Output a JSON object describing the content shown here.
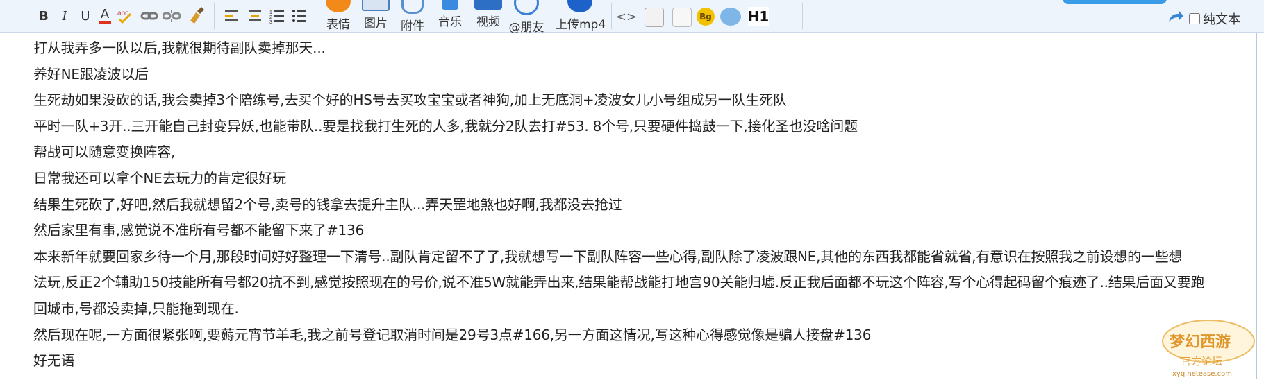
{
  "toolbar": {
    "format_buttons": [
      {
        "name": "bold-button",
        "glyph": "B"
      },
      {
        "name": "italic-button",
        "glyph": "I"
      },
      {
        "name": "underline-button",
        "glyph": "U"
      },
      {
        "name": "font-color-button",
        "glyph": "A"
      }
    ],
    "media": [
      {
        "name": "emoji-button",
        "label": "表情",
        "icon": "emoji-icon",
        "color": "#f08a1c"
      },
      {
        "name": "image-button",
        "label": "图片",
        "icon": "image-icon",
        "color": "#4a7fc1"
      },
      {
        "name": "attachment-button",
        "label": "附件",
        "icon": "attachment-icon",
        "color": "#5a8fd0"
      },
      {
        "name": "music-button",
        "label": "音乐",
        "icon": "music-icon",
        "color": "#3a8be0"
      },
      {
        "name": "video-button",
        "label": "视频",
        "icon": "video-icon",
        "color": "#2c6fc4"
      },
      {
        "name": "mention-button",
        "label": "@朋友",
        "icon": "at-icon",
        "color": "#3c7fd6"
      },
      {
        "name": "upload-mp4-button",
        "label": "上传mp4",
        "icon": "upload-icon",
        "color": "#1d62c9"
      }
    ],
    "heading_label": "H1",
    "bg_label": "Bg",
    "plain_text_label": "纯文本"
  },
  "editor": {
    "lines": [
      "打从我弄多一队以后,我就很期待副队卖掉那天...",
      "养好NE跟凌波以后",
      "生死劫如果没砍的话,我会卖掉3个陪练号,去买个好的HS号去买攻宝宝或者神狗,加上无底洞+凌波女儿小号组成另一队生死队",
      "平时一队+3开..三开能自己封变异妖,也能带队..要是找我打生死的人多,我就分2队去打#53. 8个号,只要硬件捣鼓一下,接化圣也没啥问题",
      "帮战可以随意变换阵容,",
      "日常我还可以拿个NE去玩力的肯定很好玩",
      "结果生死砍了,好吧,然后我就想留2个号,卖号的钱拿去提升主队...弄天罡地煞也好啊,我都没去抢过",
      "然后家里有事,感觉说不准所有号都不能留下来了#136",
      "本来新年就要回家乡待一个月,那段时间好好整理一下清号..副队肯定留不了了,我就想写一下副队阵容一些心得,副队除了凌波跟NE,其他的东西我都能省就省,有意识在按照我之前设想的一些想",
      "法玩,反正2个辅助150技能所有号都20抗不到,感觉按照现在的号价,说不准5W就能弄出来,结果能帮战能打地宫90关能归墟.反正我后面都不玩这个阵容,写个心得起码留个痕迹了..结果后面又要跑",
      "回城市,号都没卖掉,只能拖到现在.",
      "然后现在呢,一方面很紧张啊,要薅元宵节羊毛,我之前号登记取消时间是29号3点#166,另一方面这情况,写这种心得感觉像是骗人接盘#136",
      "好无语"
    ]
  },
  "logo": {
    "name": "梦幻西游",
    "tagline": "官方论坛",
    "url_text": "xyq.netease.com"
  }
}
